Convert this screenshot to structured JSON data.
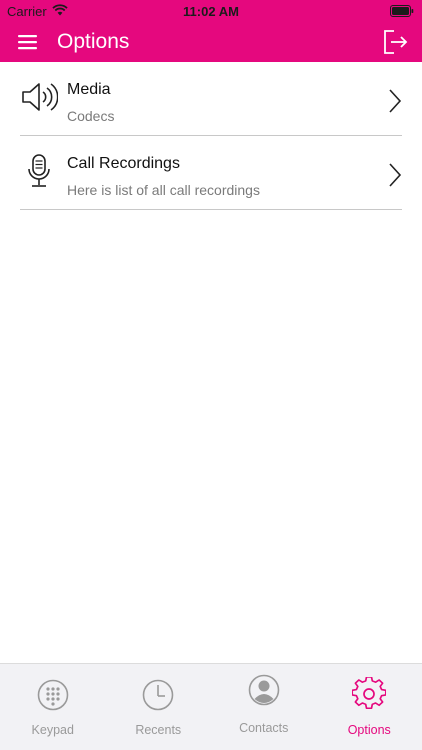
{
  "status_bar": {
    "carrier": "Carrier",
    "time": "11:02 AM"
  },
  "header": {
    "title": "Options",
    "background_color": "#e5087e"
  },
  "options": [
    {
      "title": "Media",
      "subtitle": "Codecs",
      "icon": "speaker-icon"
    },
    {
      "title": "Call Recordings",
      "subtitle": "Here is list of all call recordings",
      "icon": "microphone-icon"
    }
  ],
  "tabs": [
    {
      "label": "Keypad",
      "icon": "keypad-icon",
      "active": false
    },
    {
      "label": "Recents",
      "icon": "clock-icon",
      "active": false
    },
    {
      "label": "Contacts",
      "icon": "contact-icon",
      "active": false
    },
    {
      "label": "Options",
      "icon": "gear-icon",
      "active": true
    }
  ],
  "colors": {
    "accent": "#e5087e",
    "inactive_tab": "#9a9a9a"
  }
}
